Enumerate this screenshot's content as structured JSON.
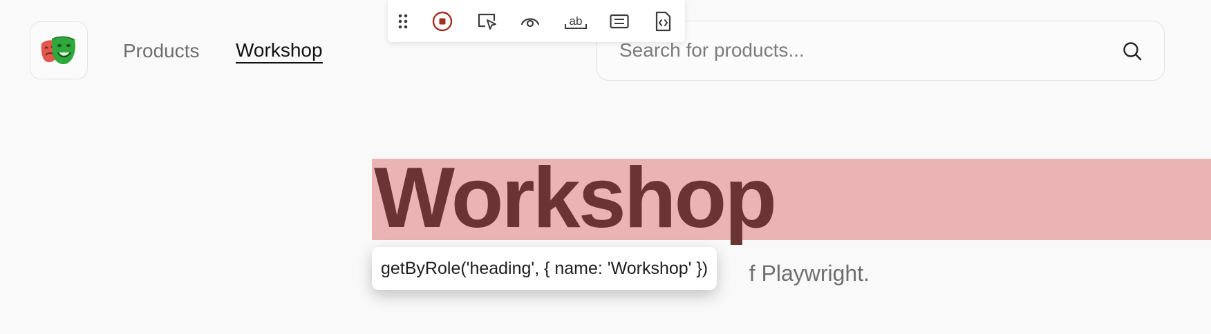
{
  "header": {
    "logo_name": "playwright-masks-logo",
    "nav": [
      {
        "label": "Products",
        "active": false
      },
      {
        "label": "Workshop",
        "active": true
      }
    ],
    "search": {
      "placeholder": "Search for products...",
      "value": "",
      "icon": "search-icon"
    }
  },
  "recorder_toolbar": {
    "items": [
      {
        "icon": "drag-handle-icon"
      },
      {
        "icon": "stop-recording-icon"
      },
      {
        "icon": "pick-locator-icon"
      },
      {
        "icon": "assert-visibility-icon"
      },
      {
        "icon": "assert-text-icon"
      },
      {
        "icon": "assert-value-icon"
      },
      {
        "icon": "assert-snapshot-icon"
      }
    ],
    "colors": {
      "record": "#a3301f",
      "icon": "#3a3a3a"
    }
  },
  "main": {
    "heading": "Workshop",
    "subtitle_visible": "f Playwright."
  },
  "locator_tooltip": {
    "text": "getByRole('heading', { name: 'Workshop' })"
  },
  "colors": {
    "background": "#f9f9f9",
    "highlight": "#eab4b4",
    "heading": "#6b3434"
  }
}
